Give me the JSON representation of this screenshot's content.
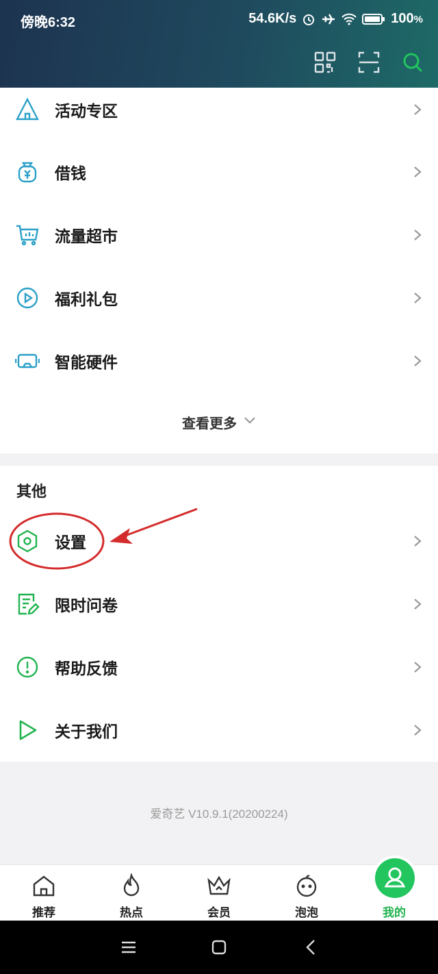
{
  "status_bar": {
    "time": "傍晚6:32",
    "net_speed": "54.6K/s",
    "battery": "100",
    "battery_unit": "%"
  },
  "menu_items": [
    {
      "label": "活动专区",
      "icon": "tent-icon"
    },
    {
      "label": "借钱",
      "icon": "money-bag-icon"
    },
    {
      "label": "流量超市",
      "icon": "cart-icon"
    },
    {
      "label": "福利礼包",
      "icon": "play-circle-icon"
    },
    {
      "label": "智能硬件",
      "icon": "vr-headset-icon"
    }
  ],
  "see_more": "查看更多",
  "other_section": {
    "title": "其他",
    "items": [
      {
        "label": "设置",
        "icon": "settings-hex-icon"
      },
      {
        "label": "限时问卷",
        "icon": "survey-icon"
      },
      {
        "label": "帮助反馈",
        "icon": "exclamation-circle-icon"
      },
      {
        "label": "关于我们",
        "icon": "play-logo-icon"
      }
    ]
  },
  "version": "爱奇艺 V10.9.1(20200224)",
  "tabbar": {
    "tabs": [
      {
        "label": "推荐",
        "icon": "home-icon"
      },
      {
        "label": "热点",
        "icon": "flame-icon"
      },
      {
        "label": "会员",
        "icon": "crown-icon"
      },
      {
        "label": "泡泡",
        "icon": "bubble-face-icon"
      },
      {
        "label": "我的",
        "icon": "user-icon"
      }
    ],
    "active_index": 4
  },
  "colors": {
    "accent": "#21b34f",
    "icon_blue": "#2aa0c8",
    "annotation": "#d42b2b"
  }
}
